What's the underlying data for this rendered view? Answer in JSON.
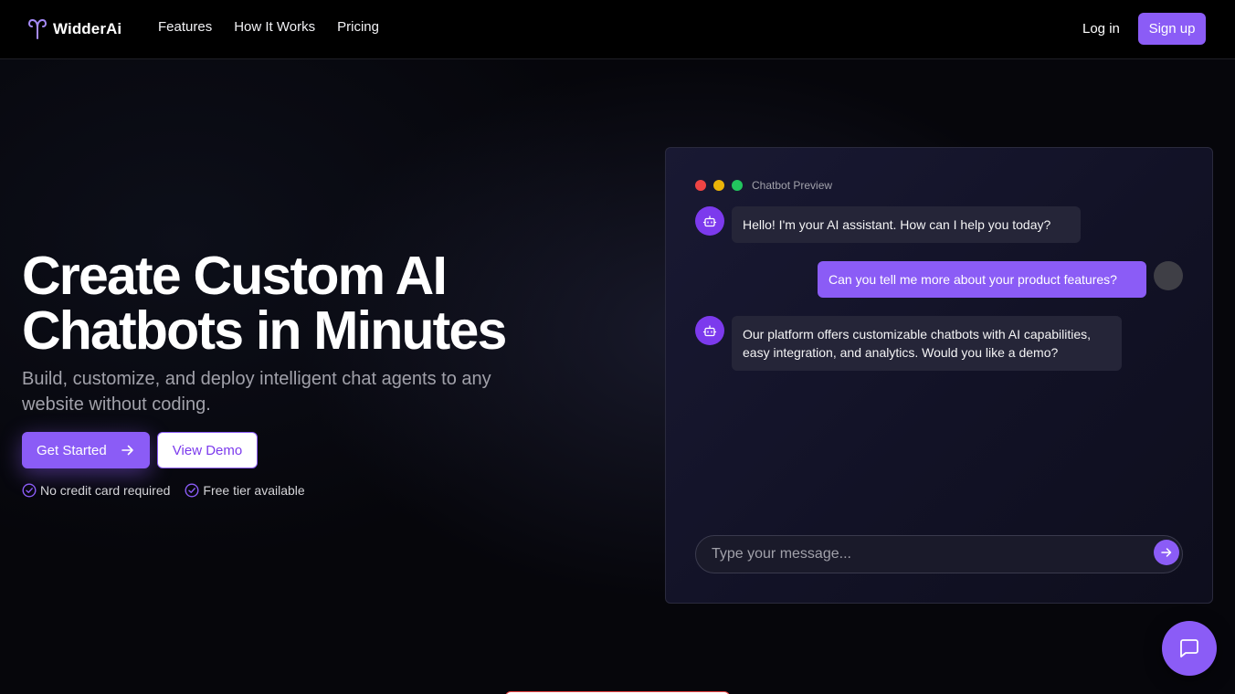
{
  "colors": {
    "accent": "#8b5cf6",
    "background": "#05050a",
    "text_muted": "#a1a1aa"
  },
  "brand": {
    "name": "WidderAi",
    "logo_icon": "aries-icon"
  },
  "nav": {
    "links": [
      {
        "label": "Features"
      },
      {
        "label": "How It Works"
      },
      {
        "label": "Pricing"
      }
    ],
    "login_label": "Log in",
    "signup_label": "Sign up"
  },
  "hero": {
    "title_line1": "Create Custom AI",
    "title_line2": "Chatbots in Minutes",
    "subtitle": "Build, customize, and deploy intelligent chat agents to any website without coding.",
    "primary_button": "Get Started",
    "primary_button_icon": "arrow-right-icon",
    "secondary_button": "View Demo",
    "perks": [
      {
        "icon": "check-circle-icon",
        "label": "No credit card required"
      },
      {
        "icon": "check-circle-icon",
        "label": "Free tier available"
      }
    ]
  },
  "chat_preview": {
    "window_dots": [
      "#ef4444",
      "#eab308",
      "#22c55e"
    ],
    "label": "Chatbot Preview",
    "messages": [
      {
        "sender": "bot",
        "text": "Hello! I'm your AI assistant. How can I help you today?"
      },
      {
        "sender": "user",
        "text": "Can you tell me more about your product features?"
      },
      {
        "sender": "bot",
        "text": "Our platform offers customizable chatbots with AI capabilities, easy integration, and analytics. Would you like a demo?"
      }
    ],
    "input_placeholder": "Type your message...",
    "send_icon": "arrow-right-icon"
  },
  "chat_launcher": {
    "icon": "message-square-icon"
  }
}
